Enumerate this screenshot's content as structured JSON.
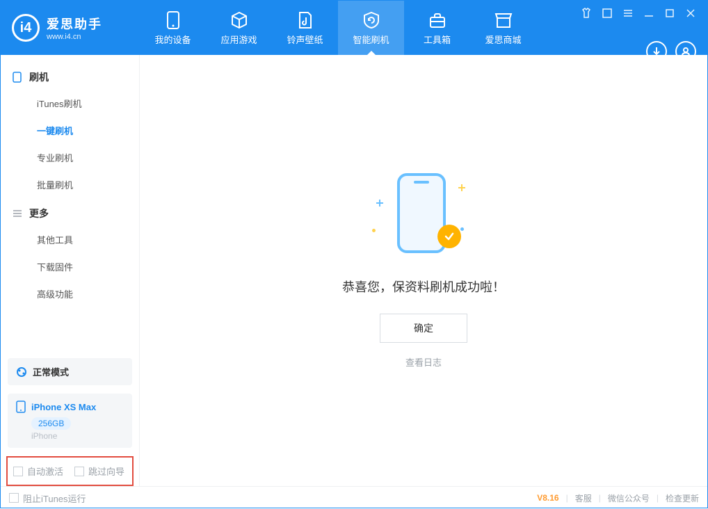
{
  "app": {
    "name_cn": "爱思助手",
    "url": "www.i4.cn"
  },
  "nav": {
    "items": [
      {
        "label": "我的设备"
      },
      {
        "label": "应用游戏"
      },
      {
        "label": "铃声壁纸"
      },
      {
        "label": "智能刷机",
        "active": true
      },
      {
        "label": "工具箱"
      },
      {
        "label": "爱思商城"
      }
    ]
  },
  "sidebar": {
    "groups": [
      {
        "title": "刷机",
        "items": [
          "iTunes刷机",
          "一键刷机",
          "专业刷机",
          "批量刷机"
        ],
        "activeIndex": 1
      },
      {
        "title": "更多",
        "items": [
          "其他工具",
          "下载固件",
          "高级功能"
        ]
      }
    ],
    "mode_label": "正常模式",
    "device": {
      "name": "iPhone XS Max",
      "storage": "256GB",
      "type": "iPhone"
    },
    "options": {
      "auto_activate": "自动激活",
      "skip_guide": "跳过向导"
    }
  },
  "main": {
    "success_msg": "恭喜您，保资料刷机成功啦！",
    "ok_btn": "确定",
    "log_link": "查看日志"
  },
  "footer": {
    "block_itunes": "阻止iTunes运行",
    "version": "V8.16",
    "links": [
      "客服",
      "微信公众号",
      "检查更新"
    ]
  }
}
